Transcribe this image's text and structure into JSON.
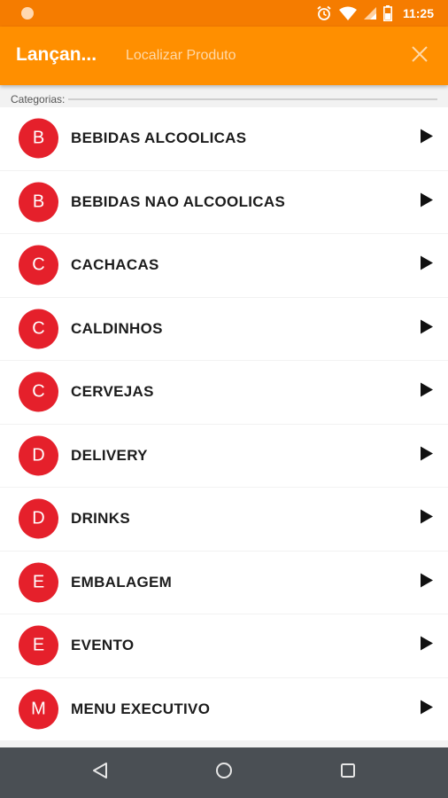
{
  "status_bar": {
    "time": "11:25"
  },
  "app_bar": {
    "title": "Lançan...",
    "search_placeholder": "Localizar Produto"
  },
  "section": {
    "label": "Categorias:"
  },
  "categories": [
    {
      "initial": "B",
      "label": "BEBIDAS ALCOOLICAS"
    },
    {
      "initial": "B",
      "label": "BEBIDAS NAO ALCOOLICAS"
    },
    {
      "initial": "C",
      "label": "CACHACAS"
    },
    {
      "initial": "C",
      "label": "CALDINHOS"
    },
    {
      "initial": "C",
      "label": "CERVEJAS"
    },
    {
      "initial": "D",
      "label": "DELIVERY"
    },
    {
      "initial": "D",
      "label": "DRINKS"
    },
    {
      "initial": "E",
      "label": "EMBALAGEM"
    },
    {
      "initial": "E",
      "label": "EVENTO"
    },
    {
      "initial": "M",
      "label": "MENU EXECUTIVO"
    }
  ],
  "colors": {
    "status_bar": "#f57c00",
    "app_bar": "#ff8f00",
    "avatar": "#e5202b",
    "nav_bar": "#4a4f54"
  },
  "icons": {
    "status": [
      "alarm-icon",
      "wifi-icon",
      "signal-icon",
      "battery-icon"
    ],
    "app_bar": "close-icon",
    "row": "play-arrow-icon",
    "nav": [
      "back-icon",
      "home-icon",
      "recents-icon"
    ]
  }
}
